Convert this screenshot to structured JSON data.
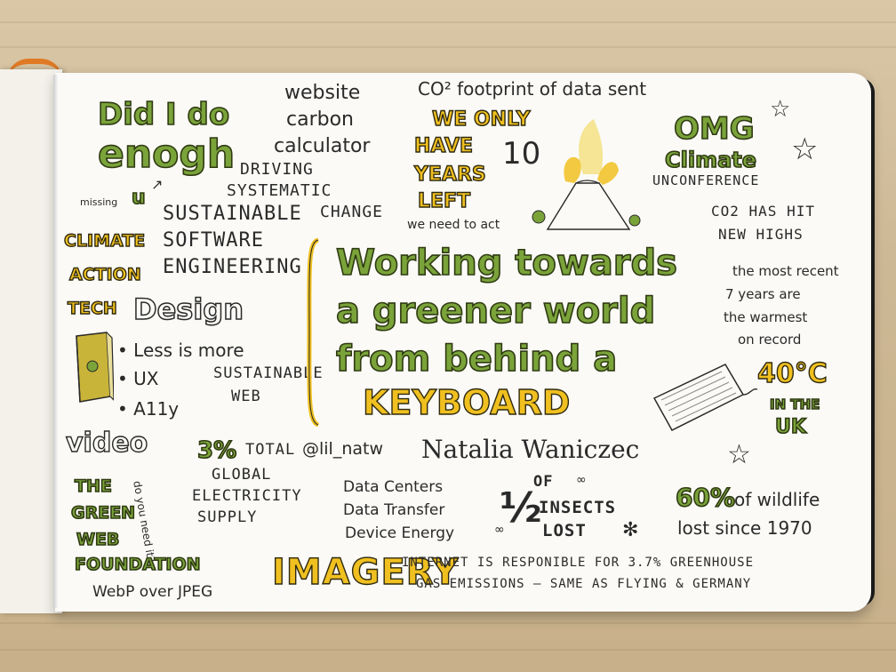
{
  "title_lines": [
    "Working towards",
    "a greener world",
    "from behind a"
  ],
  "title_keyword": "KEYBOARD",
  "did_i_do": "Did I do",
  "enough": "enogh",
  "missing": "missing",
  "u": "u",
  "website_carbon": [
    "website",
    "carbon",
    "calculator"
  ],
  "co2_footprint": "CO² footprint of data sent",
  "we_only_have": [
    "WE ONLY",
    "HAVE",
    "YEARS",
    "LEFT"
  ],
  "ten": "10",
  "we_need_to_act": "we need to act",
  "omg": "OMG",
  "climate": "Climate",
  "unconference": "UNCONFERENCE",
  "co2_highs": [
    "CO2 HAS HIT",
    "NEW HIGHS"
  ],
  "driving_change": [
    "DRIVING",
    "SYSTEMATIC",
    "CHANGE"
  ],
  "sustainable_se": [
    "SUSTAINABLE",
    "SOFTWARE",
    "ENGINEERING"
  ],
  "climate_action_tech": [
    "CLIMATE",
    "ACTION",
    "TECH"
  ],
  "design": "Design",
  "design_list": [
    "Less is more",
    "UX",
    "A11y"
  ],
  "sustainable_web": [
    "SUSTAINABLE",
    "WEB"
  ],
  "warmest": [
    "the most recent",
    "7 years are",
    "the warmest",
    "on record"
  ],
  "forty_c": "40°C",
  "in_the_uk": [
    "IN THE",
    "UK"
  ],
  "video": "video",
  "three_percent": "3%",
  "total": "TOTAL",
  "handle": "@lil_natw",
  "author": "Natalia Waniczec",
  "global_supply": [
    "GLOBAL",
    "ELECTRICITY",
    "SUPPLY"
  ],
  "do_you_need_it": "do you need it?",
  "green_web": [
    "THE",
    "GREEN",
    "WEB",
    "FOUNDATION"
  ],
  "data_list": [
    "Data Centers",
    "Data Transfer",
    "Device Energy"
  ],
  "half": "½",
  "insects": [
    "OF",
    "INSECTS",
    "LOST"
  ],
  "sixty": "60%",
  "wildlife": [
    "of wildlife",
    "lost since 1970"
  ],
  "webp": "WebP over JPEG",
  "imagery": "IMAGERY",
  "internet_line": [
    "INTERNET IS RESPONIBLE FOR 3.7% GREENHOUSE",
    "GAS EMISSIONS — SAME AS FLYING & GERMANY"
  ],
  "colors": {
    "green": "#7aa33a",
    "yellow": "#f0c020",
    "ink": "#2a2a2a",
    "paper": "#fbfaf6"
  }
}
